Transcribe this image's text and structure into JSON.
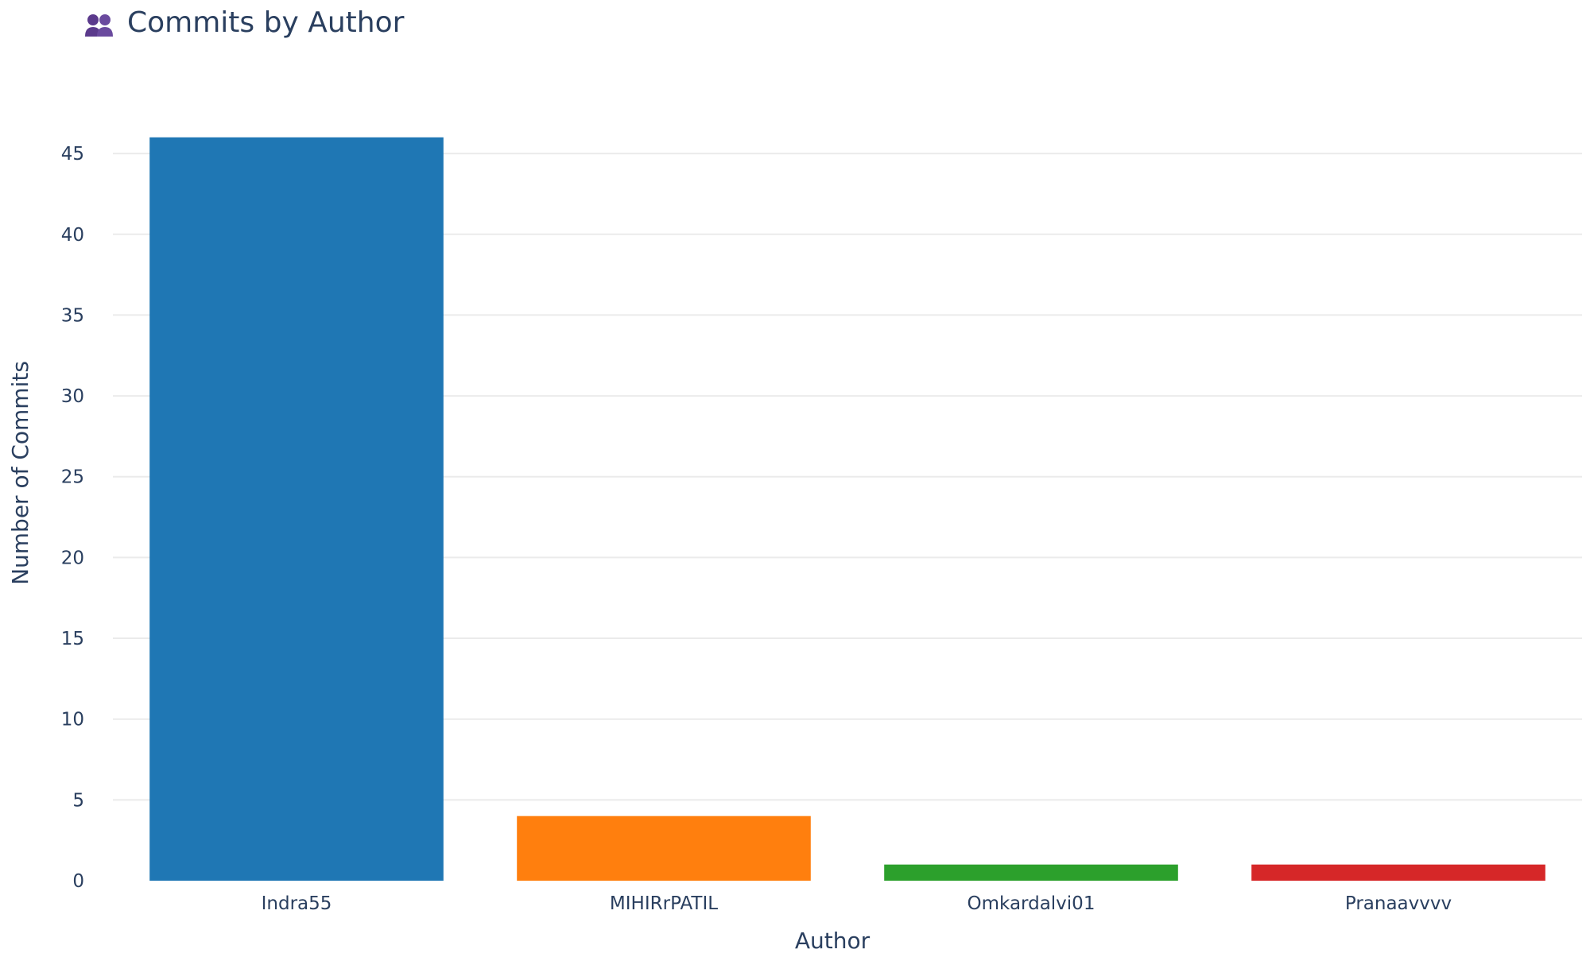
{
  "chart_data": {
    "type": "bar",
    "title": "Commits by Author",
    "title_icon": "people-icon",
    "xlabel": "Author",
    "ylabel": "Number of Commits",
    "categories": [
      "Indra55",
      "MIHIRrPATIL",
      "Omkardalvi01",
      "Pranaavvvv"
    ],
    "values": [
      46,
      4,
      1,
      1
    ],
    "colors": [
      "#1f77b4",
      "#ff7f0e",
      "#2ca02c",
      "#d62728"
    ],
    "ylim": [
      0,
      48.4
    ],
    "yticks": [
      0,
      5,
      10,
      15,
      20,
      25,
      30,
      35,
      40,
      45
    ],
    "grid": true,
    "legend": "none"
  }
}
